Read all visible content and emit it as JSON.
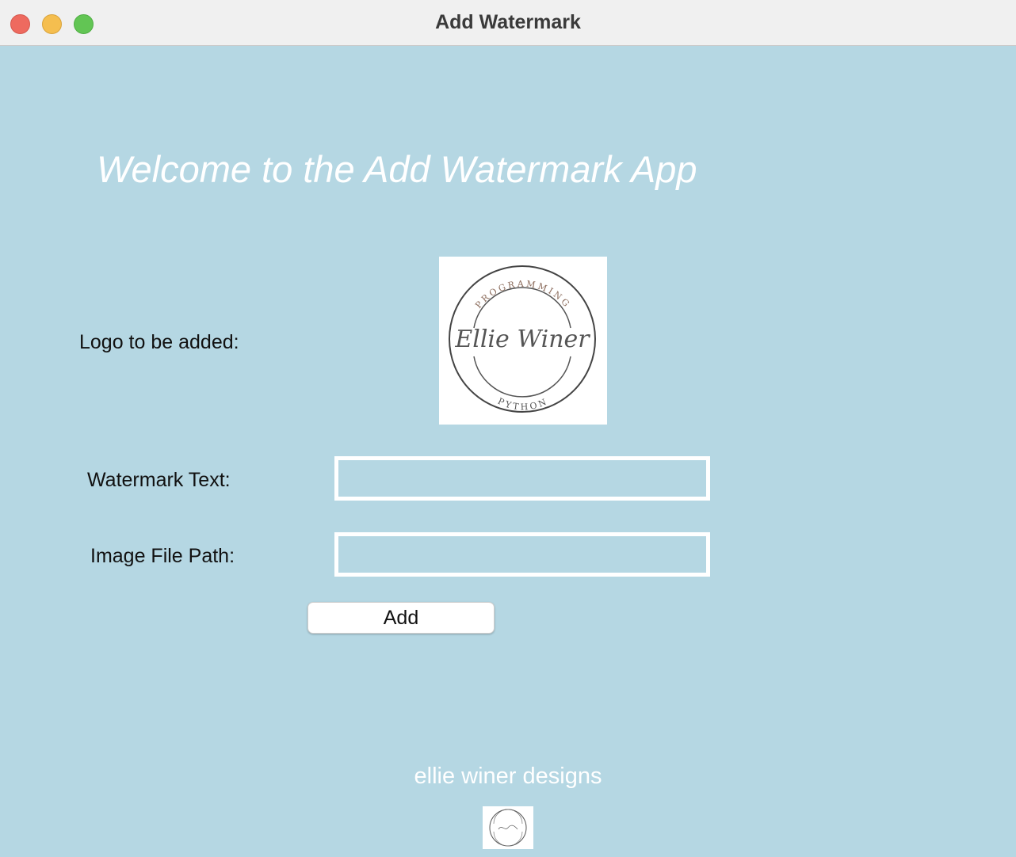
{
  "window": {
    "title": "Add Watermark"
  },
  "main": {
    "welcome_text": "Welcome to the Add Watermark App",
    "logo_label": "Logo to be added:",
    "logo": {
      "top_text": "PROGRAMMING",
      "center_text": "Ellie Winer",
      "bottom_text": "PYTHON"
    },
    "watermark_text_label": "Watermark Text:",
    "watermark_text_value": "",
    "image_path_label": "Image File Path:",
    "image_path_value": "",
    "add_button_label": "Add"
  },
  "footer": {
    "brand_text": "ellie winer designs"
  },
  "colors": {
    "background": "#b5d7e3",
    "titlebar": "#f0f0f0",
    "text_white": "#ffffff"
  }
}
